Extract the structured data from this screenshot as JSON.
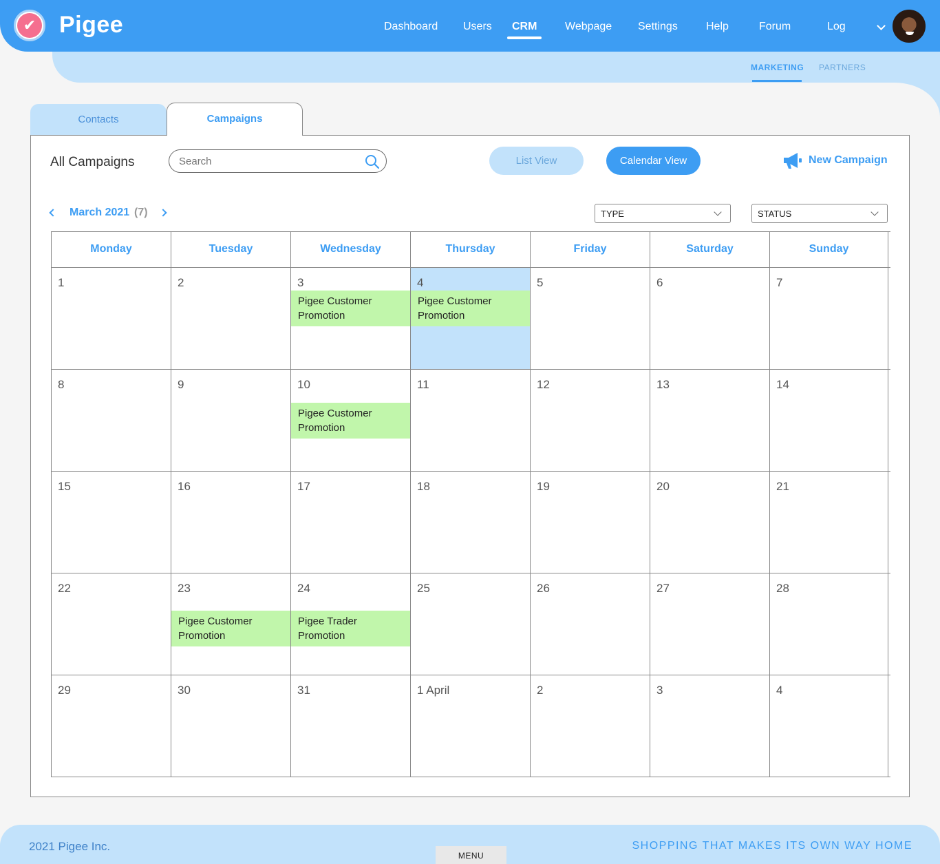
{
  "app": {
    "brand": "Pigee",
    "logo_icon": "pigee-bird-icon"
  },
  "nav": {
    "items": [
      "Dashboard",
      "Users",
      "CRM",
      "Webpage",
      "Settings",
      "Help",
      "Forum",
      "Log"
    ],
    "active": "CRM"
  },
  "subnav": {
    "items": [
      "MARKETING",
      "PARTNERS"
    ],
    "active": "MARKETING"
  },
  "tabs": [
    {
      "label": "Contacts",
      "active": false
    },
    {
      "label": "Campaigns",
      "active": true
    }
  ],
  "toolbar": {
    "title": "All Campaigns",
    "search_placeholder": "Search",
    "list_view_label": "List View",
    "calendar_view_label": "Calendar View",
    "new_campaign_label": "New Campaign"
  },
  "calendar": {
    "month_label": "March 2021",
    "count_label": "(7)",
    "filters": {
      "type": "TYPE",
      "status": "STATUS"
    },
    "weekdays": [
      "Monday",
      "Tuesday",
      "Wednesday",
      "Thursday",
      "Friday",
      "Saturday",
      "Sunday"
    ],
    "weeks": [
      [
        {
          "day": "1"
        },
        {
          "day": "2"
        },
        {
          "day": "3",
          "event": "Pigee Customer Promotion"
        },
        {
          "day": "4",
          "event": "Pigee Customer Promotion",
          "today": true
        },
        {
          "day": "5"
        },
        {
          "day": "6"
        },
        {
          "day": "7"
        }
      ],
      [
        {
          "day": "8"
        },
        {
          "day": "9"
        },
        {
          "day": "10",
          "event": "Pigee Customer Promotion"
        },
        {
          "day": "11"
        },
        {
          "day": "12"
        },
        {
          "day": "13"
        },
        {
          "day": "14"
        }
      ],
      [
        {
          "day": "15"
        },
        {
          "day": "16"
        },
        {
          "day": "17"
        },
        {
          "day": "18"
        },
        {
          "day": "19"
        },
        {
          "day": "20"
        },
        {
          "day": "21"
        }
      ],
      [
        {
          "day": "22"
        },
        {
          "day": "23",
          "event": "Pigee Customer Promotion"
        },
        {
          "day": "24",
          "event": "Pigee Trader Promotion"
        },
        {
          "day": "25"
        },
        {
          "day": "26"
        },
        {
          "day": "27"
        },
        {
          "day": "28"
        }
      ],
      [
        {
          "day": "29"
        },
        {
          "day": "30"
        },
        {
          "day": "31"
        },
        {
          "day": "1 April"
        },
        {
          "day": "2"
        },
        {
          "day": "3"
        },
        {
          "day": "4"
        }
      ]
    ]
  },
  "footer": {
    "copyright": "2021 Pigee Inc.",
    "menu_label": "MENU",
    "tagline": "SHOPPING THAT MAKES ITS OWN WAY HOME"
  },
  "colors": {
    "primary": "#3d9df3",
    "light": "#c2e2fb",
    "event": "#c1f6ab"
  }
}
